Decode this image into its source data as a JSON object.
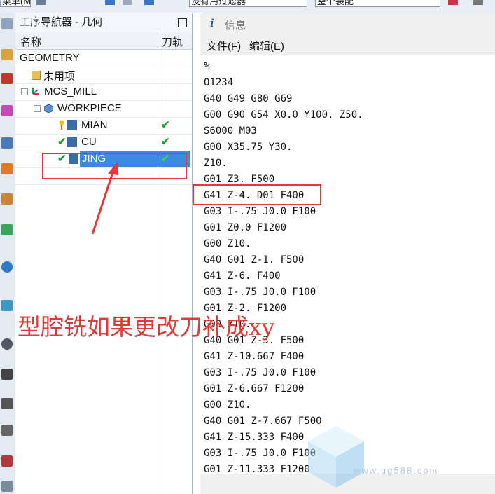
{
  "top_toolbar": {
    "left_box": "菜单(M)",
    "filter_box": "没有用过滤器",
    "scope_box": "整个装配"
  },
  "navigator": {
    "title": "工序导航器 - 几何",
    "columns": {
      "name": "名称",
      "tool_path": "刀轨"
    },
    "rows": [
      {
        "label": "GEOMETRY",
        "check": ""
      },
      {
        "label": "未用项",
        "check": ""
      },
      {
        "label": "MCS_MILL",
        "check": ""
      },
      {
        "label": "WORKPIECE",
        "check": ""
      },
      {
        "label": "MIAN",
        "check": "✔"
      },
      {
        "label": "CU",
        "check": "✔"
      },
      {
        "label": "JING",
        "check": "✔"
      }
    ]
  },
  "info_window": {
    "icon": "i",
    "title": "信息",
    "menu": {
      "file": "文件(F)",
      "edit": "编辑(E)"
    },
    "lines": [
      "%",
      "O1234",
      "G40 G49 G80 G69",
      "G00 G90 G54 X0.0 Y100. Z50.",
      "S6000 M03",
      "G00 X35.75 Y30.",
      "Z10.",
      "G01 Z3. F500",
      "G41 Z-4. D01 F400",
      "G03 I-.75 J0.0 F100",
      "G01 Z0.0 F1200",
      "G00 Z10.",
      "G40 G01 Z-1. F500",
      "G41 Z-6. F400",
      "G03 I-.75 J0.0 F100",
      "G01 Z-2. F1200",
      "G00 Z10.",
      "G40 G01 Z-3. F500",
      "G41 Z-10.667 F400",
      "G03 I-.75 J0.0 F100",
      "G01 Z-6.667 F1200",
      "G00 Z10.",
      "G40 G01 Z-7.667 F500",
      "G41 Z-15.333 F400",
      "G03 I-.75 J0.0 F100",
      "G01 Z-11.333 F1200"
    ]
  },
  "annotation": {
    "text": "型腔铣如果更改刀补成xy",
    "color": "#e53935"
  },
  "watermark": {
    "text": "www.ug588.com"
  },
  "colors": {
    "selection": "#3b8be0",
    "check": "#1fa22a",
    "annotation_red": "#e53935"
  }
}
